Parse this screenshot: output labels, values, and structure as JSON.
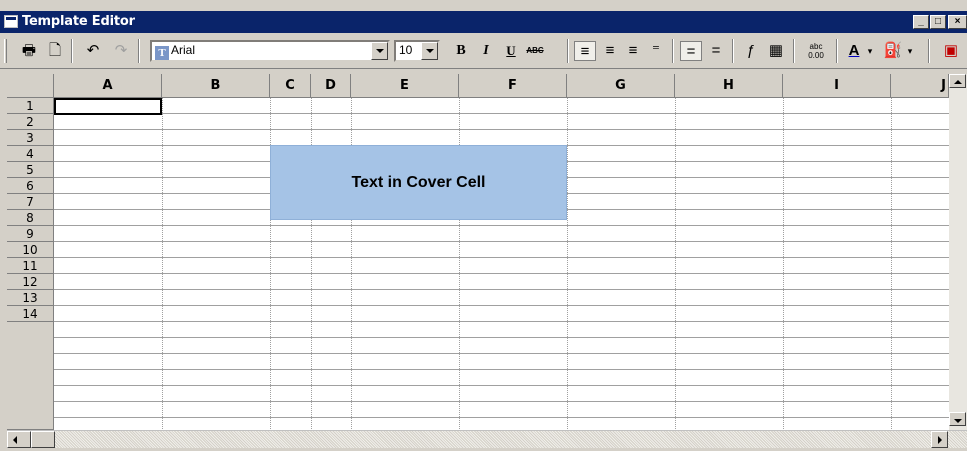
{
  "window": {
    "title": "Template Editor"
  },
  "titlebar_buttons": [
    {
      "name": "minimize-button",
      "glyph": "_"
    },
    {
      "name": "maximize-button",
      "glyph": "□"
    },
    {
      "name": "close-button",
      "glyph": "×"
    }
  ],
  "toolbar": {
    "font_name": "Arial",
    "font_size": "10",
    "bold": "B",
    "italic": "I",
    "underline": "U",
    "strike": "ABC",
    "number_format": "abc 0.00"
  },
  "columns": [
    "A",
    "B",
    "C",
    "D",
    "E",
    "F",
    "G",
    "H",
    "I",
    "J"
  ],
  "rows": [
    "1",
    "2",
    "3",
    "4",
    "5",
    "6",
    "7",
    "8",
    "9",
    "10",
    "11",
    "12",
    "13",
    "14"
  ],
  "cover_cell": {
    "text": "Text in Cover Cell",
    "range": "C3:F5",
    "color": "#a5c3e6"
  },
  "active_cell": "A1",
  "colors": {
    "titlebar": "#0a246a",
    "chrome": "#d4d0c8",
    "cover": "#a5c3e6"
  }
}
